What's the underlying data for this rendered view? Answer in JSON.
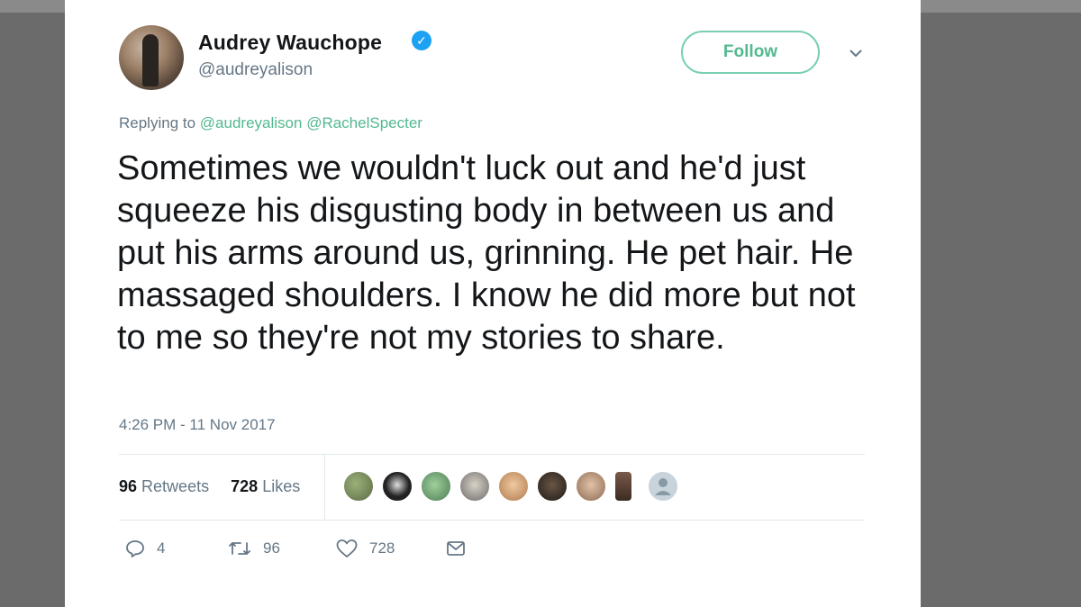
{
  "tweet": {
    "author_name": "Audrey Wauchope",
    "handle": "@audreyalison",
    "follow_label": "Follow",
    "replying_to_label": "Replying to",
    "mentions": [
      "@audreyalison",
      "@RachelSpecter"
    ],
    "text": "Sometimes we wouldn't luck out and he'd just squeeze his disgusting body in between us and put his arms around us, grinning. He pet hair. He massaged shoulders. I know he did more but not to me so they're not my stories to share.",
    "timestamp": "4:26 PM - 11 Nov 2017",
    "retweets_count": "96",
    "retweets_label": "Retweets",
    "likes_count": "728",
    "likes_label": "Likes",
    "reply_count": "4",
    "retweet_action_count": "96",
    "like_action_count": "728"
  },
  "icons": {
    "verified": "verified-badge-icon",
    "caret": "chevron-down-icon",
    "reply": "reply-icon",
    "retweet": "retweet-icon",
    "like": "heart-icon",
    "message": "envelope-icon"
  },
  "colors": {
    "accent": "#53b98f",
    "verified": "#1da1f2",
    "text": "#14171a",
    "secondary": "#657786"
  }
}
